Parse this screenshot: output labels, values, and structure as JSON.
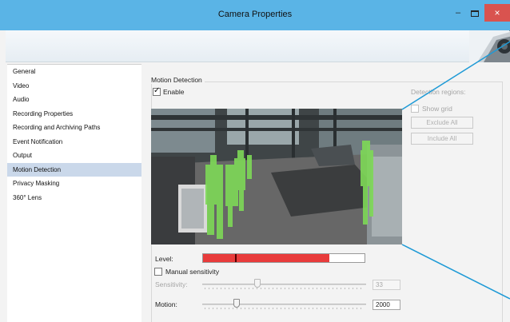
{
  "window": {
    "title": "Camera Properties"
  },
  "title_buttons": {
    "minimize": "–",
    "close": "×"
  },
  "sidebar": {
    "items": [
      {
        "label": "General",
        "selected": false
      },
      {
        "label": "Video",
        "selected": false
      },
      {
        "label": "Audio",
        "selected": false
      },
      {
        "label": "Recording Properties",
        "selected": false
      },
      {
        "label": "Recording and Archiving Paths",
        "selected": false
      },
      {
        "label": "Event Notification",
        "selected": false
      },
      {
        "label": "Output",
        "selected": false
      },
      {
        "label": "Motion Detection",
        "selected": true
      },
      {
        "label": "Privacy Masking",
        "selected": false
      },
      {
        "label": "360° Lens",
        "selected": false
      }
    ]
  },
  "motion": {
    "group_title": "Motion Detection",
    "enable_label": "Enable",
    "enable_checked": true,
    "regions_label": "Detection regions:",
    "show_grid_label": "Show grid",
    "show_grid_checked": false,
    "exclude_all_label": "Exclude All",
    "include_all_label": "Include All",
    "level_label": "Level:",
    "level_fraction": 0.78,
    "level_marker_fraction": 0.2,
    "manual_label": "Manual sensitivity",
    "manual_checked": false,
    "sensitivity_label": "Sensitivity:",
    "sensitivity_value": "33",
    "sensitivity_fraction": 0.33,
    "motion_label": "Motion:",
    "motion_value": "2000",
    "motion_fraction": 0.2
  },
  "colors": {
    "titlebar": "#5ab4e6",
    "close_button": "#d9534f",
    "selection": "#cad8ea",
    "level_fill": "#e83b3b",
    "motion_overlay": "#7ed957"
  }
}
